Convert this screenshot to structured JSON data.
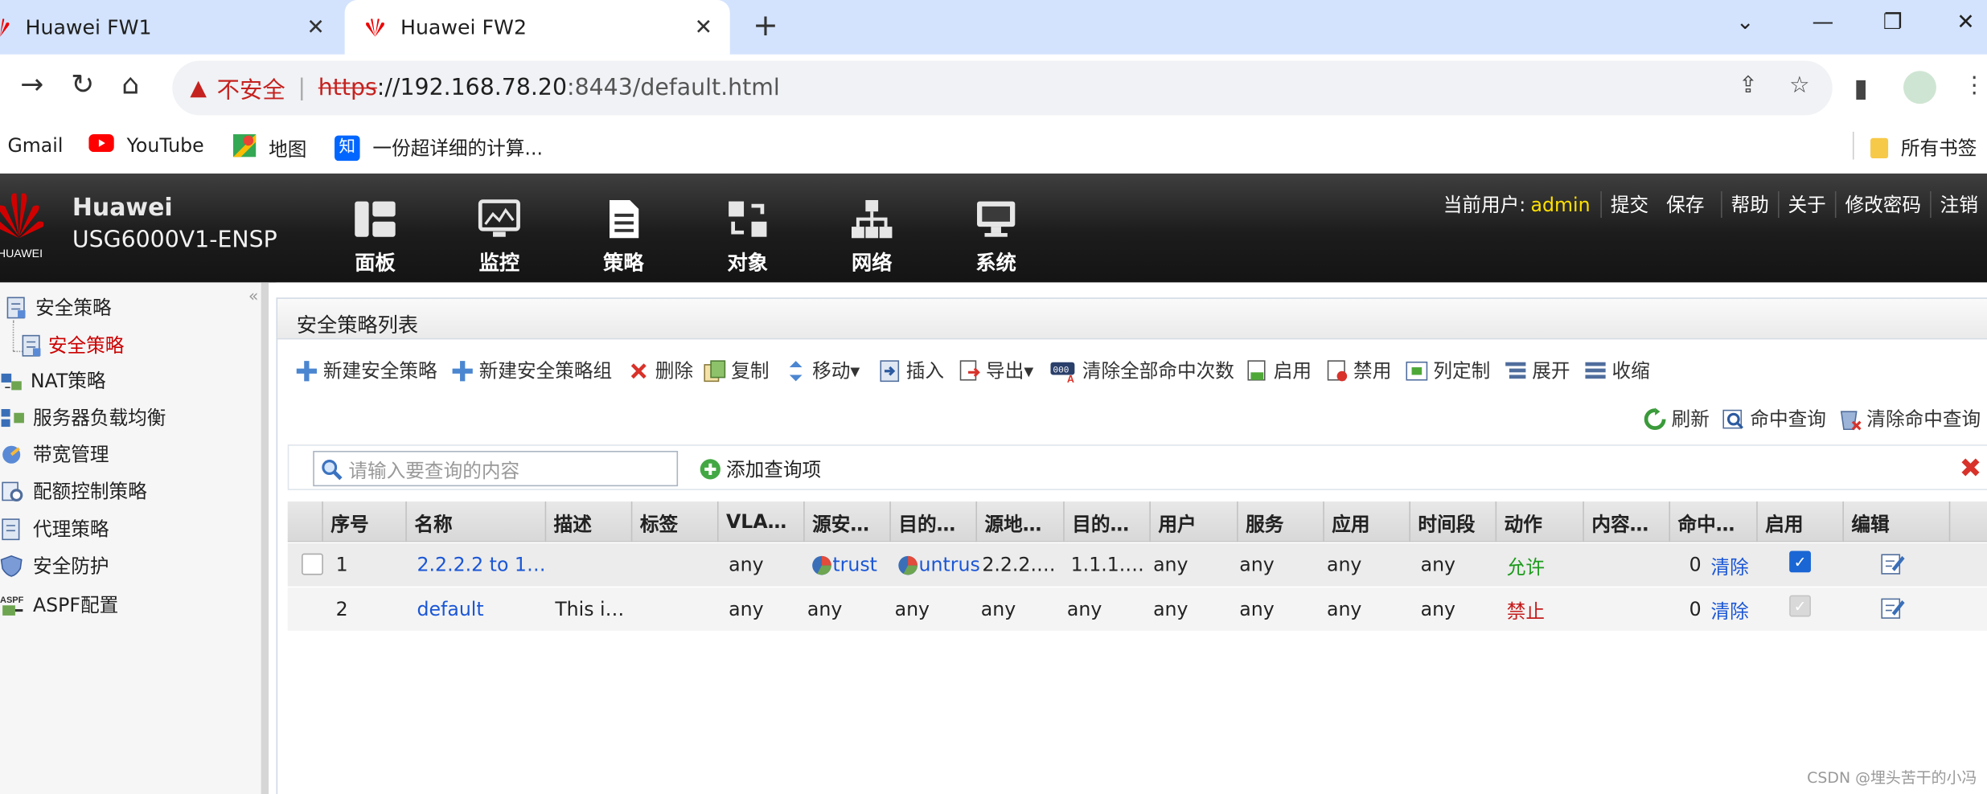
{
  "browser": {
    "tabs": [
      {
        "label": "Huawei FW1"
      },
      {
        "label": "Huawei FW2"
      }
    ],
    "new_tab_glyph": "+",
    "address": {
      "insecure_label": "不安全",
      "scheme": "https",
      "host": "://192.168.78.20",
      "path": ":8443/default.html"
    },
    "bookmarks": [
      {
        "label": "Gmail",
        "icon": "gmail-icon"
      },
      {
        "label": "YouTube",
        "icon": "youtube-icon"
      },
      {
        "label": "地图",
        "icon": "maps-icon"
      },
      {
        "label": "一份超详细的计算...",
        "icon": "zhihu-icon"
      }
    ],
    "zhihu_glyph": "知",
    "all_bookmarks": "所有书签"
  },
  "app": {
    "brand": "HUAWEI",
    "product_name": "Huawei",
    "product_model": "USG6000V1-ENSP",
    "menu": [
      {
        "label": "面板",
        "icon": "dashboard-icon"
      },
      {
        "label": "监控",
        "icon": "monitor-icon"
      },
      {
        "label": "策略",
        "icon": "policy-icon"
      },
      {
        "label": "对象",
        "icon": "object-icon"
      },
      {
        "label": "网络",
        "icon": "network-icon"
      },
      {
        "label": "系统",
        "icon": "system-icon"
      }
    ],
    "user_label": "当前用户:",
    "user_name": "admin",
    "user_links": [
      "提交",
      "保存",
      "帮助",
      "关于",
      "修改密码",
      "注销"
    ]
  },
  "sidebar": {
    "items": [
      {
        "label": "安全策略",
        "icon": "security-policy-icon"
      },
      {
        "label": "安全策略",
        "icon": "security-policy-sub-icon",
        "active": true
      },
      {
        "label": "NAT策略",
        "icon": "nat-icon"
      },
      {
        "label": "服务器负载均衡",
        "icon": "slb-icon"
      },
      {
        "label": "带宽管理",
        "icon": "bandwidth-icon"
      },
      {
        "label": "配额控制策略",
        "icon": "quota-icon"
      },
      {
        "label": "代理策略",
        "icon": "proxy-icon"
      },
      {
        "label": "安全防护",
        "icon": "shield-icon"
      },
      {
        "label": "ASPF配置",
        "icon": "aspf-icon"
      }
    ],
    "collapse_glyph": "«"
  },
  "main": {
    "title": "安全策略列表",
    "toolbar": [
      {
        "label": "新建安全策略",
        "icon": "add-icon"
      },
      {
        "label": "新建安全策略组",
        "icon": "add-group-icon"
      },
      {
        "label": "删除",
        "icon": "delete-icon"
      },
      {
        "label": "复制",
        "icon": "copy-icon"
      },
      {
        "label": "移动▾",
        "icon": "move-icon"
      },
      {
        "label": "插入",
        "icon": "insert-icon"
      },
      {
        "label": "导出▾",
        "icon": "export-icon"
      },
      {
        "label": "清除全部命中次数",
        "icon": "clear-hits-icon"
      },
      {
        "label": "启用",
        "icon": "enable-icon"
      },
      {
        "label": "禁用",
        "icon": "disable-icon"
      },
      {
        "label": "列定制",
        "icon": "columns-icon"
      },
      {
        "label": "展开",
        "icon": "expand-icon"
      },
      {
        "label": "收缩",
        "icon": "collapse-icon"
      }
    ],
    "toolbar2": [
      {
        "label": "刷新",
        "icon": "refresh-icon"
      },
      {
        "label": "命中查询",
        "icon": "hit-query-icon"
      },
      {
        "label": "清除命中查询",
        "icon": "clear-hit-query-icon"
      }
    ],
    "search": {
      "placeholder": "请输入要查询的内容",
      "add_label": "添加查询项"
    },
    "columns": [
      "序号",
      "名称",
      "描述",
      "标签",
      "VLA…",
      "源安…",
      "目的…",
      "源地…",
      "目的…",
      "用户",
      "服务",
      "应用",
      "时间段",
      "动作",
      "内容…",
      "命中…",
      "启用",
      "编辑"
    ],
    "rows": [
      {
        "no": "1",
        "name": "2.2.2.2 to 1…",
        "desc": "",
        "tag": "",
        "vlan": "any",
        "src_zone": "trust",
        "dst_zone": "untrust",
        "src_addr": "2.2.2.…",
        "dst_addr": "1.1.1.…",
        "user": "any",
        "service": "any",
        "app": "any",
        "time": "any",
        "action": "允许",
        "content": "",
        "hits": "0",
        "hits_clear": "清除",
        "enabled": true
      },
      {
        "no": "2",
        "name": "default",
        "desc": "This i…",
        "tag": "",
        "vlan": "any",
        "src_zone": "any",
        "dst_zone": "any",
        "src_addr": "any",
        "dst_addr": "any",
        "user": "any",
        "service": "any",
        "app": "any",
        "time": "any",
        "action": "禁止",
        "content": "",
        "hits": "0",
        "hits_clear": "清除",
        "enabled": true
      }
    ]
  },
  "watermark": "CSDN @埋头苦干的小冯",
  "colors": {
    "accent": "#c00000",
    "link": "#1a56d6",
    "allow": "#1c9a1c",
    "deny": "#c41a1a",
    "user": "#ffe000"
  }
}
